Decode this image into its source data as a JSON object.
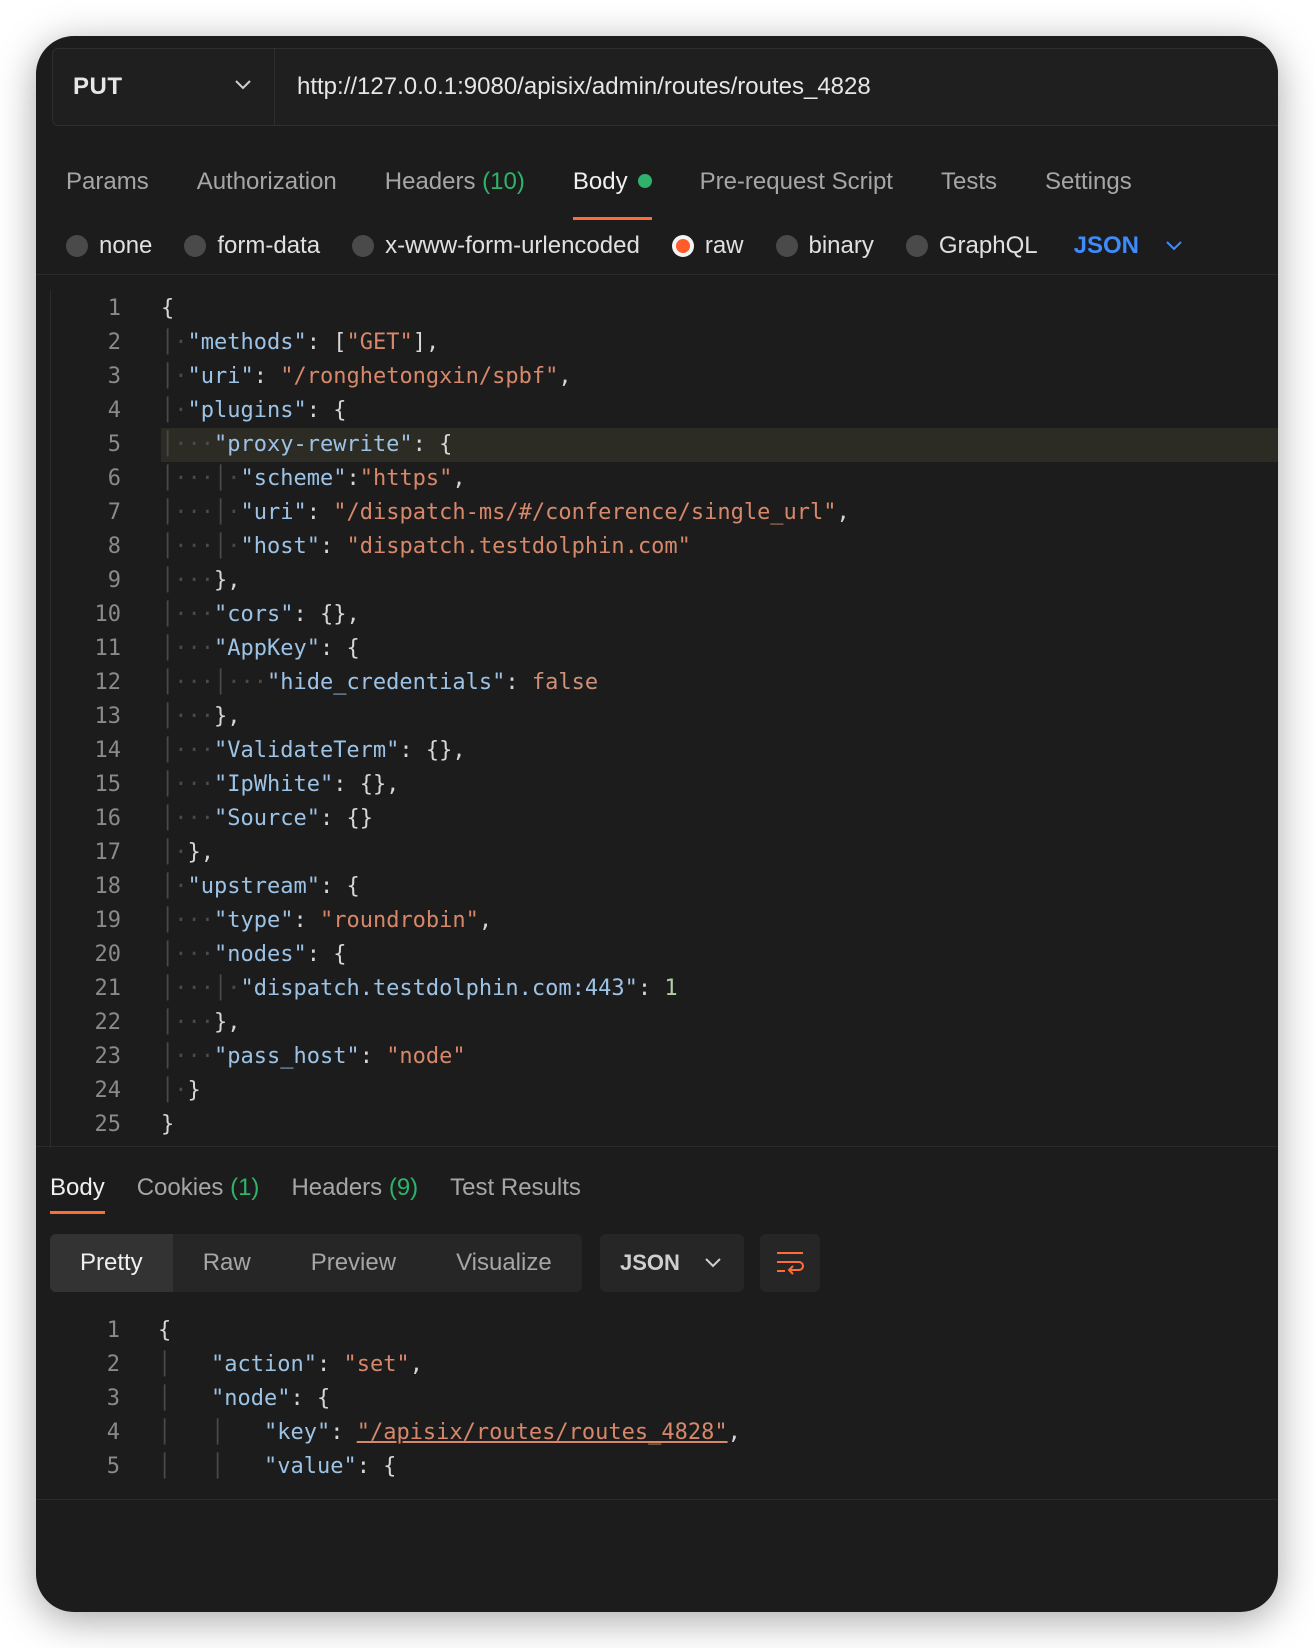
{
  "request": {
    "method": "PUT",
    "url": "http://127.0.0.1:9080/apisix/admin/routes/routes_4828"
  },
  "request_tabs": [
    {
      "label": "Params",
      "count": ""
    },
    {
      "label": "Authorization",
      "count": ""
    },
    {
      "label": "Headers",
      "count": "(10)"
    },
    {
      "label": "Body",
      "count": ""
    },
    {
      "label": "Pre-request Script",
      "count": ""
    },
    {
      "label": "Tests",
      "count": ""
    },
    {
      "label": "Settings",
      "count": ""
    }
  ],
  "body_types": [
    "none",
    "form-data",
    "x-www-form-urlencoded",
    "raw",
    "binary",
    "GraphQL"
  ],
  "selected_body_type": "raw",
  "body_format": "JSON",
  "request_body_lines": [
    "1",
    "2",
    "3",
    "4",
    "5",
    "6",
    "7",
    "8",
    "9",
    "10",
    "11",
    "12",
    "13",
    "14",
    "15",
    "16",
    "17",
    "18",
    "19",
    "20",
    "21",
    "22",
    "23",
    "24",
    "25"
  ],
  "request_body": {
    "l1": "{",
    "l2a": "\"methods\"",
    "l2b": ": [",
    "l2c": "\"GET\"",
    "l2d": "],",
    "l3a": "\"uri\"",
    "l3b": ": ",
    "l3c": "\"/ronghetongxin/spbf\"",
    "l3d": ",",
    "l4a": "\"plugins\"",
    "l4b": ": {",
    "l5a": "\"proxy-rewrite\"",
    "l5b": ": {",
    "l6a": "\"scheme\"",
    "l6b": ":",
    "l6c": "\"https\"",
    "l6d": ",",
    "l7a": "\"uri\"",
    "l7b": ": ",
    "l7c": "\"/dispatch-ms/#/conference/single_url\"",
    "l7d": ",",
    "l8a": "\"host\"",
    "l8b": ": ",
    "l8c": "\"dispatch.testdolphin.com\"",
    "l9": "},",
    "l10a": "\"cors\"",
    "l10b": ": {},",
    "l11a": "\"AppKey\"",
    "l11b": ": {",
    "l12a": "\"hide_credentials\"",
    "l12b": ": ",
    "l12c": "false",
    "l13": "},",
    "l14a": "\"ValidateTerm\"",
    "l14b": ": {},",
    "l15a": "\"IpWhite\"",
    "l15b": ": {},",
    "l16a": "\"Source\"",
    "l16b": ": {}",
    "l17": "},",
    "l18a": "\"upstream\"",
    "l18b": ": {",
    "l19a": "\"type\"",
    "l19b": ": ",
    "l19c": "\"roundrobin\"",
    "l19d": ",",
    "l20a": "\"nodes\"",
    "l20b": ": {",
    "l21a": "\"dispatch.testdolphin.com:443\"",
    "l21b": ": ",
    "l21c": "1",
    "l22": "},",
    "l23a": "\"pass_host\"",
    "l23b": ": ",
    "l23c": "\"node\"",
    "l24": "}",
    "l25": "}"
  },
  "response_tabs": [
    {
      "label": "Body",
      "count": ""
    },
    {
      "label": "Cookies",
      "count": "(1)"
    },
    {
      "label": "Headers",
      "count": "(9)"
    },
    {
      "label": "Test Results",
      "count": ""
    }
  ],
  "response_views": [
    "Pretty",
    "Raw",
    "Preview",
    "Visualize"
  ],
  "response_format": "JSON",
  "response_body_lines": [
    "1",
    "2",
    "3",
    "4",
    "5"
  ],
  "response_body": {
    "l1": "{",
    "l2a": "\"action\"",
    "l2b": ": ",
    "l2c": "\"set\"",
    "l2d": ",",
    "l3a": "\"node\"",
    "l3b": ": {",
    "l4a": "\"key\"",
    "l4b": ": ",
    "l4c": "\"/apisix/routes/routes_4828\"",
    "l4d": ",",
    "l5a": "\"value\"",
    "l5b": ": {"
  },
  "colors": {
    "accent_orange": "#ff6c37",
    "count_green": "#2fb36b",
    "format_blue": "#3d8bfd",
    "background": "#1c1c1c"
  },
  "icons": [
    "chevron-down-icon",
    "wrap-lines-icon"
  ]
}
